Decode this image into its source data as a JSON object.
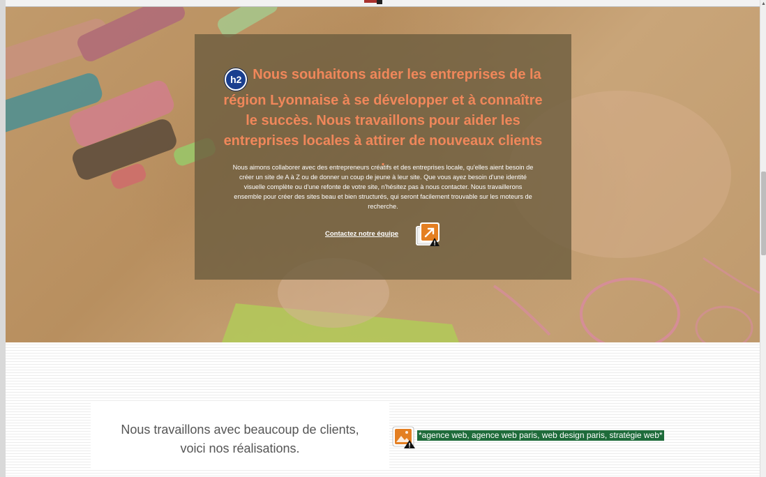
{
  "hero": {
    "h2_badge": "h2",
    "headline": "Nous souhaitons aider les entreprises de la région Lyonnaise à se développer et à connaître le succès. Nous travaillons pour aider les entreprises locales à attirer de nouveaux clients .",
    "body": "Nous aimons collaborer avec des entrepreneurs créatifs et des entreprises locale, qu'elles aient besoin de créer un site de A à Z ou de donner un coup de jeune à leur site. Que vous ayez besoin d'une identité visuelle complète ou d'une refonte de votre site, n'hésitez pas à nous contacter. Nous travaillerons ensemble pour créer des sites beau et bien structurés, qui seront facilement trouvable sur les moteurs de recherche.",
    "cta_label": "Contactez notre équipe",
    "cta_icon": "external-link-warning-icon"
  },
  "clients": {
    "line1": "Nous travaillons avec beaucoup de clients,",
    "line2": "voici nos réalisations.",
    "image_icon": "broken-image-warning-icon",
    "image_alt": "*agence web, agence web paris, web design paris, stratégie web*"
  },
  "colors": {
    "headline": "#f0875a",
    "overlay": "#6e5e40",
    "alt_badge": "#1e6b3a",
    "h2_badge": "#1a3f8f"
  }
}
